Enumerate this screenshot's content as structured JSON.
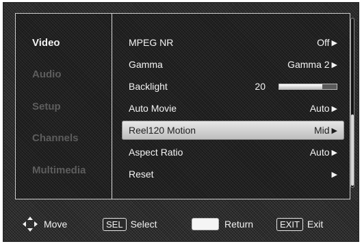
{
  "sidebar": {
    "items": [
      {
        "label": "Video",
        "active": true
      },
      {
        "label": "Audio",
        "active": false
      },
      {
        "label": "Setup",
        "active": false
      },
      {
        "label": "Channels",
        "active": false
      },
      {
        "label": "Multimedia",
        "active": false
      }
    ]
  },
  "menu": {
    "rows": [
      {
        "label": "MPEG NR",
        "value": "Off"
      },
      {
        "label": "Gamma",
        "value": "Gamma 2"
      },
      {
        "label": "Backlight",
        "value": "20",
        "slider_level": 0.75
      },
      {
        "label": "Auto Movie",
        "value": "Auto"
      },
      {
        "label": "Reel120 Motion",
        "value": "Mid",
        "selected": true
      },
      {
        "label": "Aspect Ratio",
        "value": "Auto"
      },
      {
        "label": "Reset",
        "value": ""
      }
    ],
    "arrow_glyph": "▶"
  },
  "footer": {
    "move": "Move",
    "sel_key": "SEL",
    "select": "Select",
    "return": "Return",
    "exit_key": "EXIT",
    "exit": "Exit"
  },
  "colors": {
    "background": "#1f1f1f",
    "text": "#f4f4f4",
    "dim_text": "#5d5d5d",
    "highlight": "#d0d0d0"
  }
}
